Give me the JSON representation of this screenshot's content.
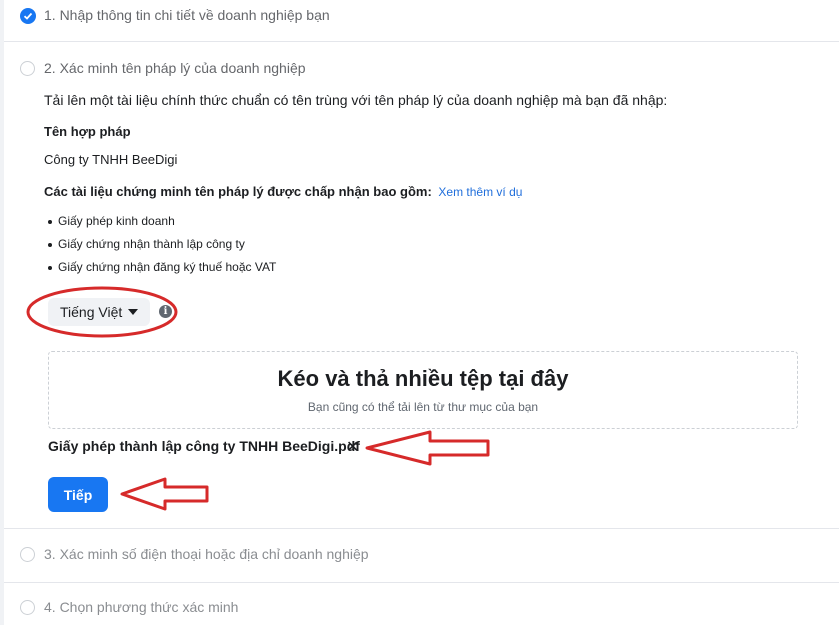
{
  "steps": {
    "step1": {
      "label": "1. Nhập thông tin chi tiết về doanh nghiệp bạn",
      "status": "completed"
    },
    "step2": {
      "label": "2. Xác minh tên pháp lý của doanh nghiệp",
      "status": "active"
    },
    "step3": {
      "label": "3. Xác minh số điện thoại hoặc địa chỉ doanh nghiệp",
      "status": "pending"
    },
    "step4": {
      "label": "4. Chọn phương thức xác minh",
      "status": "pending"
    }
  },
  "content": {
    "intro": "Tải lên một tài liệu chính thức chuẩn có tên trùng với tên pháp lý của doanh nghiệp mà bạn đã nhập:",
    "legal_name_label": "Tên hợp pháp",
    "legal_name_value": "Công ty TNHH BeeDigi",
    "accepted_docs_label": "Các tài liệu chứng minh tên pháp lý được chấp nhận bao gồm:",
    "see_examples_link": "Xem thêm ví dụ",
    "accepted_docs": [
      "Giấy phép kinh doanh",
      "Giấy chứng nhận thành lập công ty",
      "Giấy chứng nhận đăng ký thuế hoặc VAT"
    ],
    "language_selector": "Tiếng Việt",
    "info_glyph": "i",
    "dropzone_title": "Kéo và thả nhiều tệp tại đây",
    "dropzone_subtitle": "Bạn cũng có thể tải lên từ thư mục của bạn",
    "uploaded_file": "Giấy phép thành lập công ty TNHH BeeDigi.pdf",
    "remove_glyph": "✕",
    "next_button": "Tiếp"
  },
  "colors": {
    "accent": "#1877f2",
    "link": "#216fdb",
    "annotation": "#d62a2a"
  }
}
